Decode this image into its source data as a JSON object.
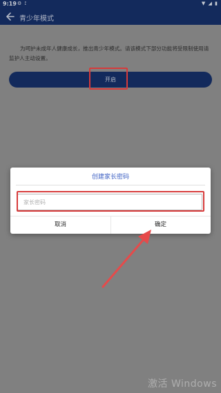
{
  "status_bar": {
    "time": "9:19",
    "left_icons": [
      "settings-icon",
      "signal-antenna-icon"
    ],
    "right_icons": [
      "wifi-icon",
      "signal-icon",
      "battery-icon"
    ]
  },
  "app_bar": {
    "title": "青少年模式",
    "back_icon": "arrow-left-icon"
  },
  "main": {
    "notice": "为呵护未成年人健康成长，推出青少年模式。请该模式下部分功能将受限制使用请监护人主动设置。",
    "enable_label": "开启"
  },
  "dialog": {
    "title": "创建家长密码",
    "password_placeholder": "家长密码",
    "password_value": "",
    "cancel_label": "取消",
    "confirm_label": "确定"
  },
  "watermark": "激活 Windows",
  "colors": {
    "navy": "#132a5c",
    "overlay_gray": "#808080",
    "dialog_title_blue": "#3f62c4",
    "annotation_red": "#d73a3a"
  }
}
